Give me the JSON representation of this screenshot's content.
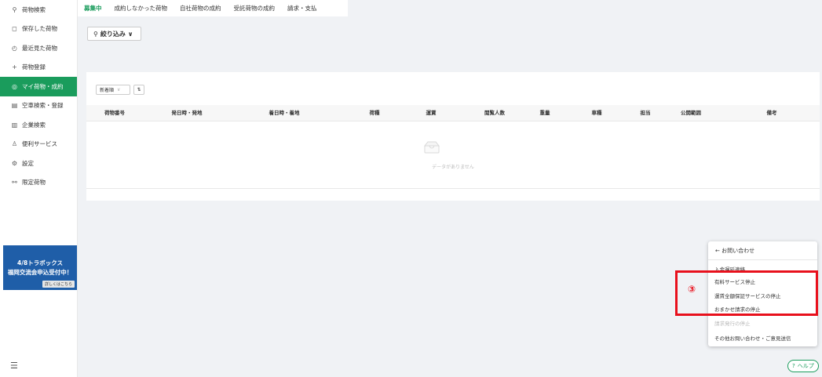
{
  "sidebar": {
    "items": [
      {
        "icon": "search-icon",
        "glyph": "⚲",
        "label": "荷物検索"
      },
      {
        "icon": "bookmark-icon",
        "glyph": "◻",
        "label": "保存した荷物"
      },
      {
        "icon": "clock-icon",
        "glyph": "◴",
        "label": "最近見た荷物"
      },
      {
        "icon": "plus-icon",
        "glyph": "+",
        "label": "荷物登録"
      },
      {
        "icon": "target-icon",
        "glyph": "◎",
        "label": "マイ荷物・成約"
      },
      {
        "icon": "truck-list-icon",
        "glyph": "▤",
        "label": "空車検索・登録"
      },
      {
        "icon": "building-icon",
        "glyph": "▥",
        "label": "企業検索"
      },
      {
        "icon": "person-icon",
        "glyph": "♙",
        "label": "便利サービス"
      },
      {
        "icon": "gear-icon",
        "glyph": "⚙",
        "label": "設定"
      },
      {
        "icon": "handshake-icon",
        "glyph": "⚯",
        "label": "限定荷物"
      }
    ],
    "active_index": 4,
    "banner": {
      "line1": "4/8トラボックス",
      "line2": "福岡交流会申込受付中！",
      "detail": "詳しくはこちら"
    },
    "collapse_glyph": "☰"
  },
  "tabs": [
    {
      "label": "募集中",
      "active": true
    },
    {
      "label": "成約しなかった荷物",
      "active": false
    },
    {
      "label": "自社荷物の成約",
      "active": false
    },
    {
      "label": "受託荷物の成約",
      "active": false
    },
    {
      "label": "請求・支払",
      "active": false
    }
  ],
  "filter": {
    "label": "絞り込み",
    "chevron": "∨"
  },
  "sort": {
    "label": "新着順",
    "chevron": "∨",
    "direction_glyph": "⇅"
  },
  "table": {
    "columns": [
      "荷物番号",
      "発日時・発地",
      "着日時・着地",
      "荷種",
      "運賃",
      "閲覧人数",
      "重量",
      "車種",
      "担当",
      "公開範囲",
      "備考"
    ],
    "empty_text": "データがありません"
  },
  "menu": {
    "back_label": "← お問い合わせ",
    "items": [
      {
        "label": "入金遅延連絡",
        "disabled": false
      },
      {
        "label": "有料サービス停止",
        "disabled": false
      },
      {
        "label": "運賃全額保証サービスの停止",
        "disabled": false
      },
      {
        "label": "おまかせ請求の停止",
        "disabled": false
      },
      {
        "label": "請求発行の停止",
        "disabled": true
      },
      {
        "label": "その他お問い合わせ・ご意見送信",
        "disabled": false
      }
    ]
  },
  "annotation": {
    "number": "③",
    "color": "#e8101c"
  },
  "help": {
    "label": "ヘルプ",
    "glyph": "?"
  },
  "colors": {
    "accent": "#1a9c5c",
    "banner": "#1f5ea8",
    "highlight": "#e8101c"
  }
}
